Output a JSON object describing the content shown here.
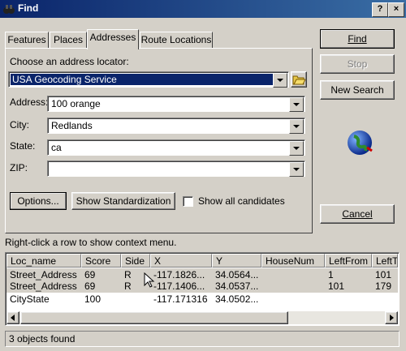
{
  "window": {
    "title": "Find",
    "help_button": "?",
    "close_button": "×"
  },
  "tabs": [
    {
      "label": "Features"
    },
    {
      "label": "Places"
    },
    {
      "label": "Addresses"
    },
    {
      "label": "Route Locations"
    }
  ],
  "locator": {
    "label": "Choose an address locator:",
    "value": "USA Geocoding Service"
  },
  "fields": {
    "address": {
      "label": "Address:",
      "value": "100 orange"
    },
    "city": {
      "label": "City:",
      "value": "Redlands"
    },
    "state": {
      "label": "State:",
      "value": "ca"
    },
    "zip": {
      "label": "ZIP:",
      "value": ""
    }
  },
  "actions": {
    "options": "Options...",
    "show_standardization": "Show Standardization",
    "show_all_candidates": "Show all candidates"
  },
  "side_buttons": {
    "find": "Find",
    "stop": "Stop",
    "new_search": "New Search",
    "cancel": "Cancel"
  },
  "hint": "Right-click a row to show context menu.",
  "results": {
    "columns": [
      "Loc_name",
      "Score",
      "Side",
      "X",
      "Y",
      "HouseNum",
      "LeftFrom",
      "LeftT"
    ],
    "rows": [
      [
        "Street_Address",
        "69",
        "R",
        "-117.1826...",
        "34.0564...",
        "",
        "1",
        "101"
      ],
      [
        "Street_Address",
        "69",
        "R",
        "-117.1406...",
        "34.0537...",
        "",
        "101",
        "179"
      ],
      [
        "CityState",
        "100",
        "",
        "-117.171316",
        "34.0502...",
        "",
        "",
        ""
      ]
    ]
  },
  "status": "3 objects found"
}
